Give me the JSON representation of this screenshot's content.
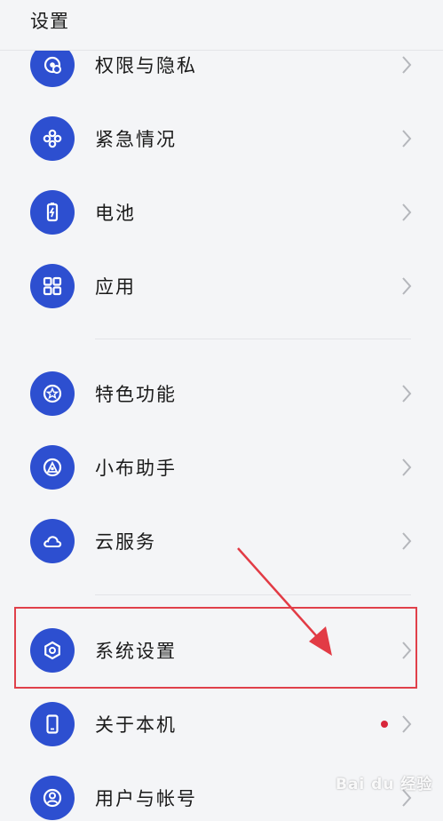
{
  "header": {
    "title": "设置"
  },
  "items": [
    {
      "label": "权限与隐私",
      "icon": "privacy-icon"
    },
    {
      "label": "紧急情况",
      "icon": "emergency-icon"
    },
    {
      "label": "电池",
      "icon": "battery-icon"
    },
    {
      "label": "应用",
      "icon": "apps-icon"
    },
    {
      "label": "特色功能",
      "icon": "feature-icon"
    },
    {
      "label": "小布助手",
      "icon": "assistant-icon"
    },
    {
      "label": "云服务",
      "icon": "cloud-icon"
    },
    {
      "label": "系统设置",
      "icon": "system-settings-icon"
    },
    {
      "label": "关于本机",
      "icon": "phone-icon",
      "badge": "red-dot"
    },
    {
      "label": "用户与帐号",
      "icon": "user-icon"
    }
  ],
  "watermark": "Bai du 经验",
  "colors": {
    "icon_bg": "#2d4fd0",
    "highlight": "#e0404a",
    "badge": "#d8263b",
    "background": "#f4f5f7"
  }
}
